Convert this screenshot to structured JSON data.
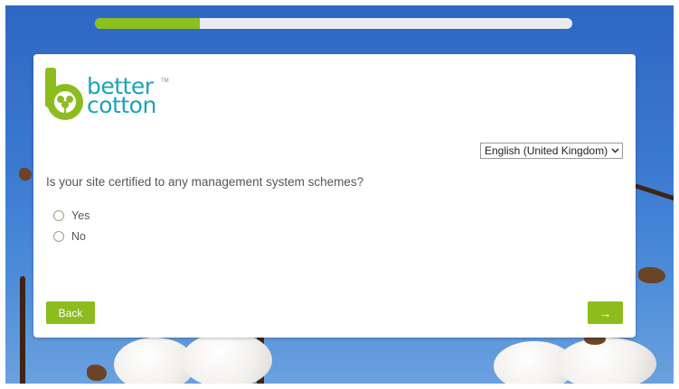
{
  "progress": {
    "fraction": 0.22,
    "track_color": "#e8ecef",
    "fill_color": "#8cc01a"
  },
  "logo": {
    "line1": "better",
    "line2": "cotton",
    "trademark": "TM",
    "brand_color": "#1aa4b8",
    "mark_color": "#8cbc1e"
  },
  "language": {
    "selected": "English (United Kingdom)",
    "chevron_icon": "chevron-down-icon"
  },
  "question": {
    "text": "Is your site certified to any management system schemes?"
  },
  "options": [
    {
      "label": "Yes",
      "selected": false
    },
    {
      "label": "No",
      "selected": false
    }
  ],
  "nav": {
    "back_label": "Back",
    "next_label": "→",
    "accent": "#8cbc1e"
  }
}
